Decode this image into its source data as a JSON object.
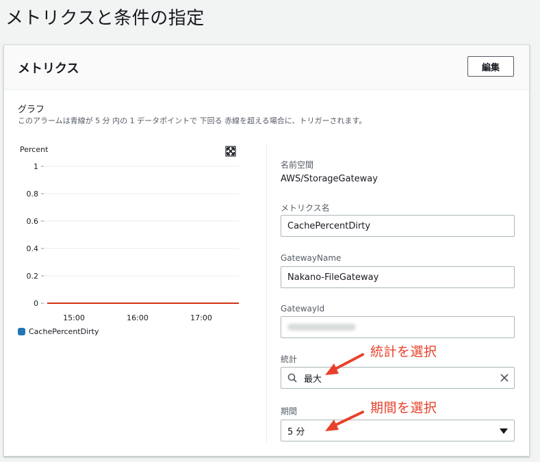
{
  "page": {
    "title": "メトリクスと条件の指定"
  },
  "panel": {
    "title": "メトリクス",
    "edit_label": "編集"
  },
  "graph": {
    "title": "グラフ",
    "description": "このアラームは青線が 5 分 内の 1 データポイントで 下回る 赤線を超える場合に、トリガーされます。"
  },
  "chart_data": {
    "type": "line",
    "ylabel": "Percent",
    "ylim": [
      0,
      1
    ],
    "y_ticks": [
      "1",
      "0.8",
      "0.6",
      "0.4",
      "0.2",
      "0"
    ],
    "x_ticks": [
      "15:00",
      "16:00",
      "17:00"
    ],
    "grid": true,
    "legend_position": "bottom-left",
    "series": [
      {
        "name": "CachePercentDirty",
        "color": "#1f77b4",
        "values": []
      }
    ],
    "threshold": {
      "value": 0,
      "color": "#d13212"
    }
  },
  "details": {
    "namespace_label": "名前空間",
    "namespace_value": "AWS/StorageGateway",
    "metric_name_label": "メトリクス名",
    "metric_name_value": "CachePercentDirty",
    "gateway_name_label": "GatewayName",
    "gateway_name_value": "Nakano-FileGateway",
    "gateway_id_label": "GatewayId",
    "statistic_label": "統計",
    "statistic_value": "最大",
    "period_label": "期間",
    "period_value": "5 分"
  },
  "annotations": {
    "statistic_note": "統計を選択",
    "period_note": "期間を選択",
    "color": "#e8412b"
  },
  "icons": [
    "expand-icon",
    "search-icon",
    "clear-icon",
    "caret-down-icon"
  ]
}
